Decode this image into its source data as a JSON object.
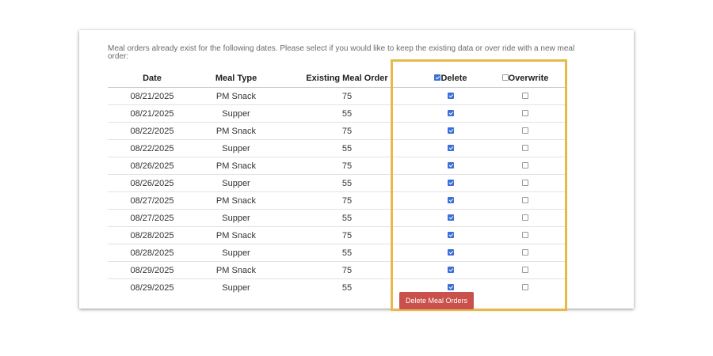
{
  "intro_text": "Meal orders already exist for the following dates. Please select if you would like to keep the existing data or over ride with a new meal order:",
  "columns": {
    "date": "Date",
    "meal_type": "Meal Type",
    "existing": "Existing Meal Order",
    "delete": "Delete",
    "overwrite": "Overwrite"
  },
  "header_checks": {
    "delete_checked": true,
    "overwrite_checked": false
  },
  "rows": [
    {
      "date": "08/21/2025",
      "meal_type": "PM Snack",
      "existing": "75",
      "delete": true,
      "overwrite": false
    },
    {
      "date": "08/21/2025",
      "meal_type": "Supper",
      "existing": "55",
      "delete": true,
      "overwrite": false
    },
    {
      "date": "08/22/2025",
      "meal_type": "PM Snack",
      "existing": "75",
      "delete": true,
      "overwrite": false
    },
    {
      "date": "08/22/2025",
      "meal_type": "Supper",
      "existing": "55",
      "delete": true,
      "overwrite": false
    },
    {
      "date": "08/26/2025",
      "meal_type": "PM Snack",
      "existing": "75",
      "delete": true,
      "overwrite": false
    },
    {
      "date": "08/26/2025",
      "meal_type": "Supper",
      "existing": "55",
      "delete": true,
      "overwrite": false
    },
    {
      "date": "08/27/2025",
      "meal_type": "PM Snack",
      "existing": "75",
      "delete": true,
      "overwrite": false
    },
    {
      "date": "08/27/2025",
      "meal_type": "Supper",
      "existing": "55",
      "delete": true,
      "overwrite": false
    },
    {
      "date": "08/28/2025",
      "meal_type": "PM Snack",
      "existing": "75",
      "delete": true,
      "overwrite": false
    },
    {
      "date": "08/28/2025",
      "meal_type": "Supper",
      "existing": "55",
      "delete": true,
      "overwrite": false
    },
    {
      "date": "08/29/2025",
      "meal_type": "PM Snack",
      "existing": "75",
      "delete": true,
      "overwrite": false
    },
    {
      "date": "08/29/2025",
      "meal_type": "Supper",
      "existing": "55",
      "delete": true,
      "overwrite": false
    }
  ],
  "button_label": "Delete Meal Orders",
  "colors": {
    "highlight": "#e8b84a",
    "button": "#c9504b",
    "checkbox": "#3a6fd8"
  }
}
